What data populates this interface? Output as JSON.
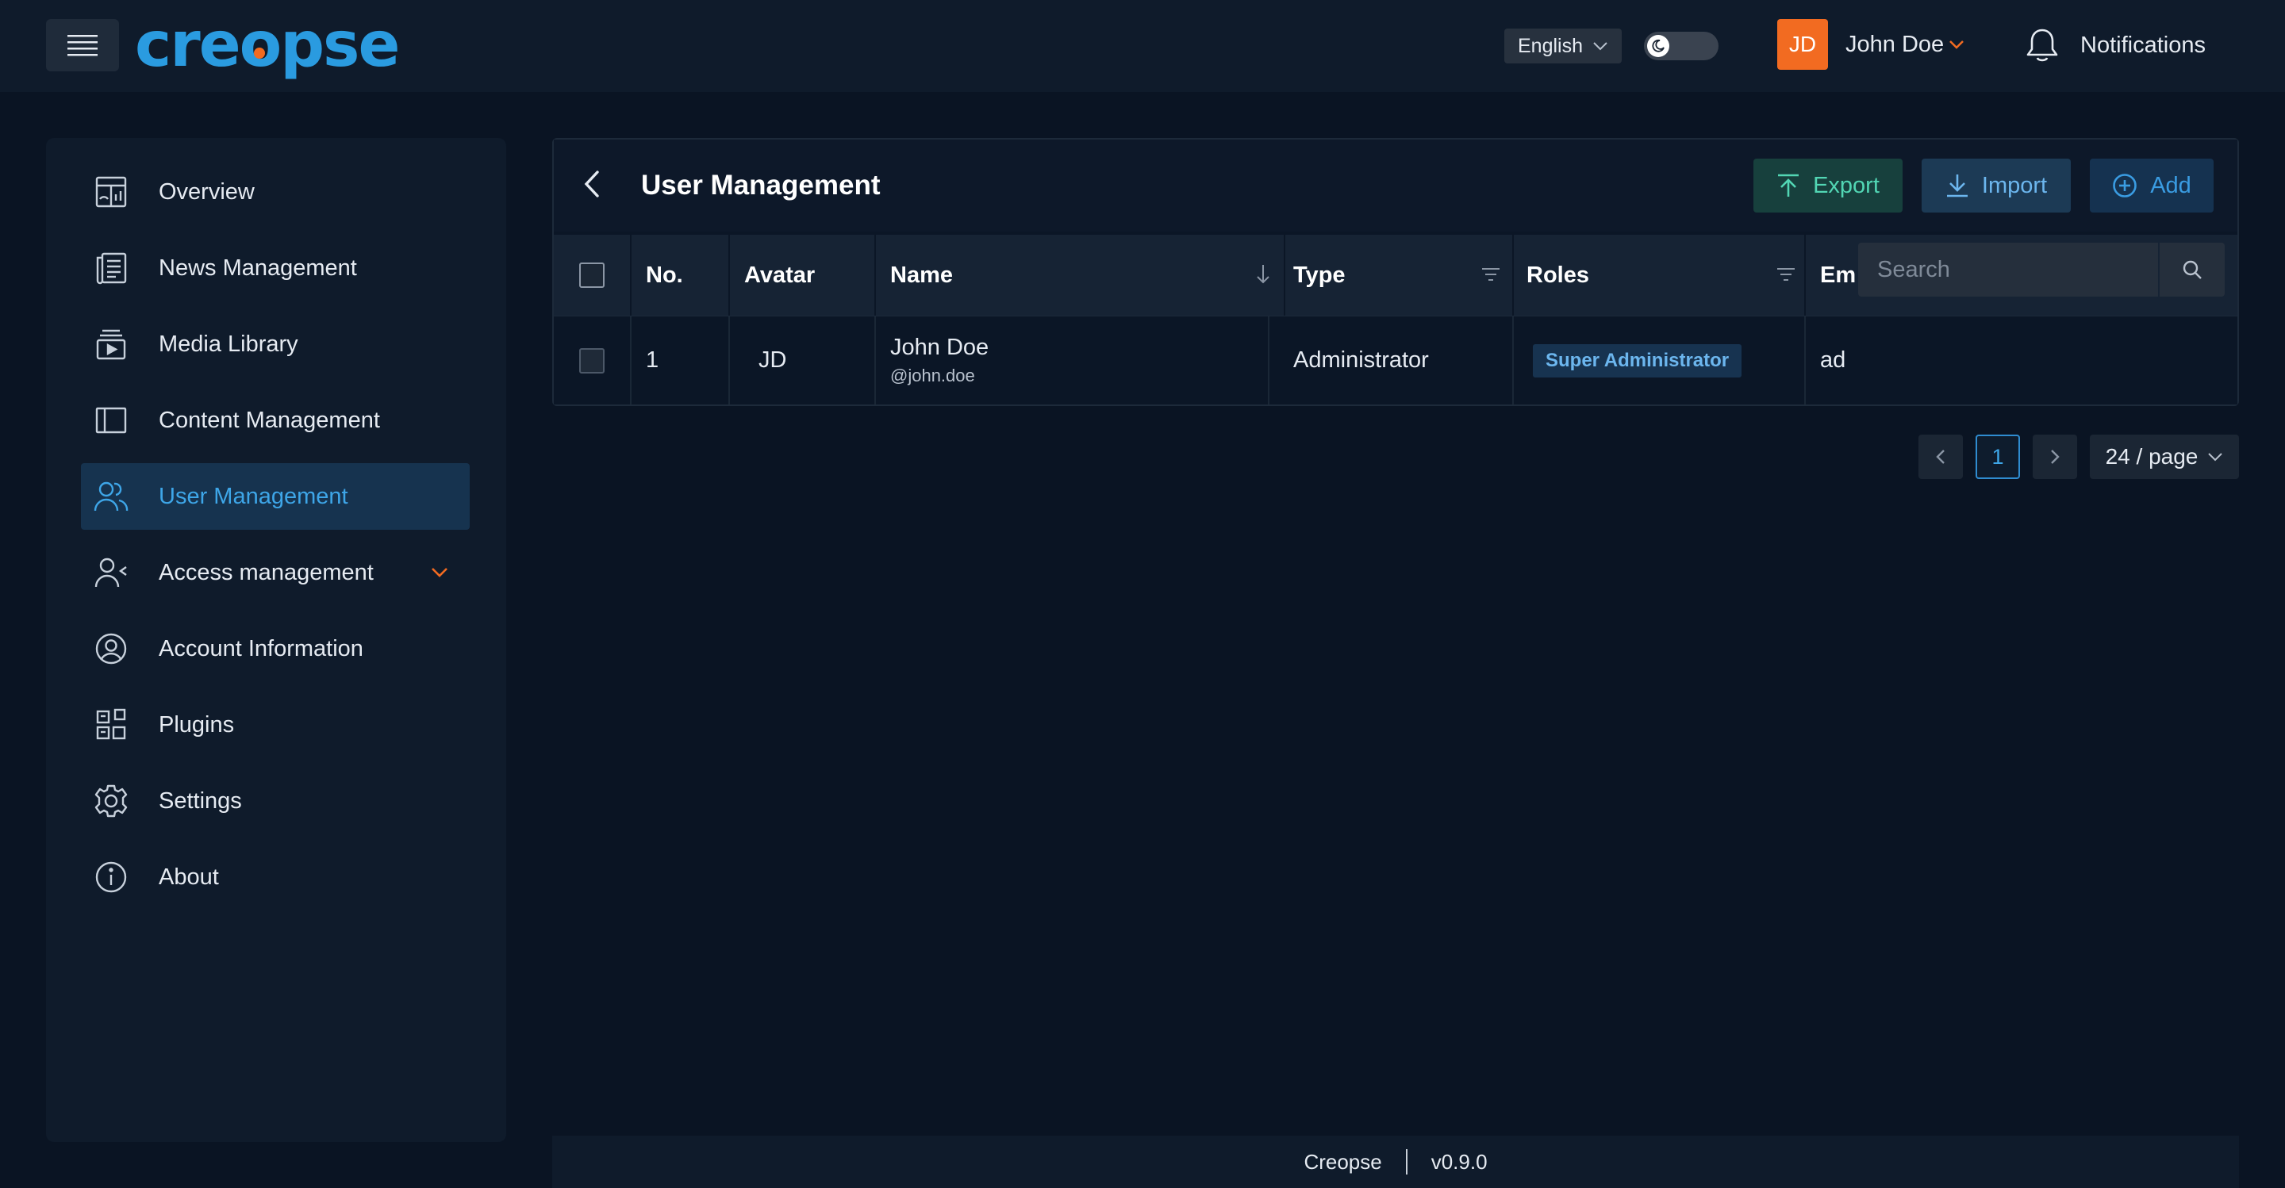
{
  "header": {
    "logo_text": "creopse",
    "language": "English",
    "user": {
      "initials": "JD",
      "name": "John Doe"
    },
    "notifications_label": "Notifications"
  },
  "sidebar": {
    "items": [
      {
        "label": "Overview",
        "icon": "dashboard-icon"
      },
      {
        "label": "News Management",
        "icon": "news-icon"
      },
      {
        "label": "Media Library",
        "icon": "media-icon"
      },
      {
        "label": "Content Management",
        "icon": "layout-icon"
      },
      {
        "label": "User Management",
        "icon": "users-icon",
        "active": true
      },
      {
        "label": "Access management",
        "icon": "user-access-icon",
        "expandable": true
      },
      {
        "label": "Account Information",
        "icon": "account-icon"
      },
      {
        "label": "Plugins",
        "icon": "plugins-icon"
      },
      {
        "label": "Settings",
        "icon": "gear-icon"
      },
      {
        "label": "About",
        "icon": "info-icon"
      }
    ]
  },
  "main": {
    "title": "User Management",
    "actions": {
      "export": "Export",
      "import": "Import",
      "add": "Add"
    },
    "search_placeholder": "Search",
    "table": {
      "columns": {
        "no": "No.",
        "avatar": "Avatar",
        "name": "Name",
        "type": "Type",
        "roles": "Roles",
        "email": "Em"
      },
      "rows": [
        {
          "no": "1",
          "avatar": "JD",
          "name": "John Doe",
          "username": "@john.doe",
          "type": "Administrator",
          "role": "Super Administrator",
          "email": "ad"
        }
      ]
    },
    "pagination": {
      "current": "1",
      "page_size": "24 / page"
    }
  },
  "footer": {
    "app": "Creopse",
    "version": "v0.9.0"
  },
  "colors": {
    "accent": "#2a9be0",
    "brand_orange": "#f26b21",
    "export_green": "#52d6b4"
  }
}
